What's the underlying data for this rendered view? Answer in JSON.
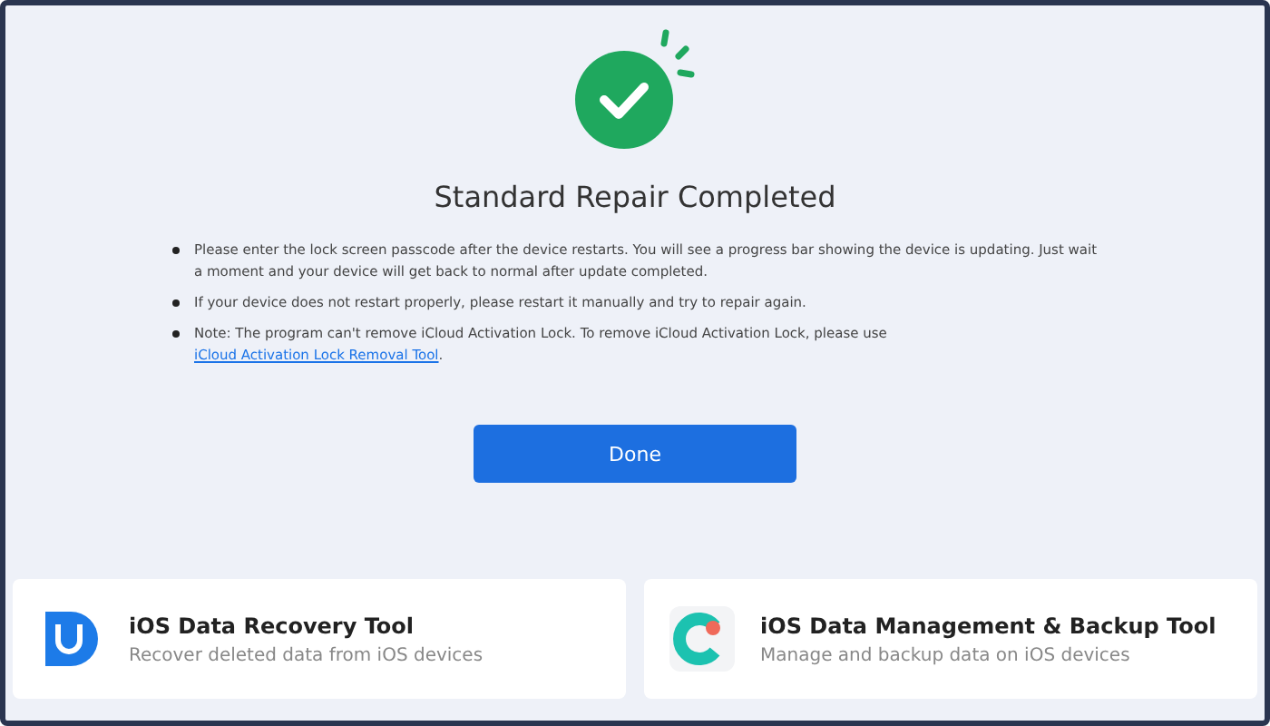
{
  "result": {
    "title": "Standard Repair Completed"
  },
  "notes": [
    {
      "text": "Please enter the lock screen passcode after the device restarts. You will see a progress bar showing the device is updating. Just wait a moment and your device will get back to normal after update completed."
    },
    {
      "text": "If your device does not restart properly, please restart it manually and try to repair again."
    },
    {
      "text": "Note: The program can't remove iCloud Activation Lock. To remove iCloud Activation Lock, please use ",
      "link": "iCloud Activation Lock Removal Tool",
      "after": "."
    }
  ],
  "done_button": "Done",
  "tools": [
    {
      "kind": "recovery",
      "title": "iOS Data Recovery Tool",
      "subtitle": "Recover deleted data from iOS devices"
    },
    {
      "kind": "backup",
      "title": "iOS Data Management & Backup Tool",
      "subtitle": "Manage and backup data on iOS devices"
    }
  ]
}
